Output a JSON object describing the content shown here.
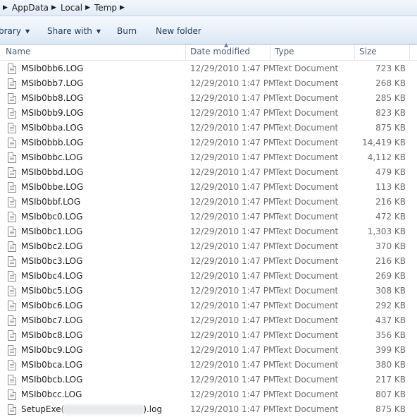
{
  "address": {
    "crumbs": [
      "AppData",
      "Local",
      "Temp"
    ]
  },
  "toolbar": {
    "library_label": "brary",
    "share_label": "Share with",
    "burn_label": "Burn",
    "new_folder_label": "New folder"
  },
  "columns": {
    "name": "Name",
    "date": "Date modified",
    "type": "Type",
    "size": "Size"
  },
  "files": [
    {
      "name": "MSIb0bb6.LOG",
      "date": "12/29/2010 1:47 PM",
      "type": "Text Document",
      "size": "723 KB"
    },
    {
      "name": "MSIb0bb7.LOG",
      "date": "12/29/2010 1:47 PM",
      "type": "Text Document",
      "size": "268 KB"
    },
    {
      "name": "MSIb0bb8.LOG",
      "date": "12/29/2010 1:47 PM",
      "type": "Text Document",
      "size": "285 KB"
    },
    {
      "name": "MSIb0bb9.LOG",
      "date": "12/29/2010 1:47 PM",
      "type": "Text Document",
      "size": "823 KB"
    },
    {
      "name": "MSIb0bba.LOG",
      "date": "12/29/2010 1:47 PM",
      "type": "Text Document",
      "size": "875 KB"
    },
    {
      "name": "MSIb0bbb.LOG",
      "date": "12/29/2010 1:47 PM",
      "type": "Text Document",
      "size": "14,419 KB"
    },
    {
      "name": "MSIb0bbc.LOG",
      "date": "12/29/2010 1:47 PM",
      "type": "Text Document",
      "size": "4,112 KB"
    },
    {
      "name": "MSIb0bbd.LOG",
      "date": "12/29/2010 1:47 PM",
      "type": "Text Document",
      "size": "479 KB"
    },
    {
      "name": "MSIb0bbe.LOG",
      "date": "12/29/2010 1:47 PM",
      "type": "Text Document",
      "size": "113 KB"
    },
    {
      "name": "MSIb0bbf.LOG",
      "date": "12/29/2010 1:47 PM",
      "type": "Text Document",
      "size": "216 KB"
    },
    {
      "name": "MSIb0bc0.LOG",
      "date": "12/29/2010 1:47 PM",
      "type": "Text Document",
      "size": "472 KB"
    },
    {
      "name": "MSIb0bc1.LOG",
      "date": "12/29/2010 1:47 PM",
      "type": "Text Document",
      "size": "1,303 KB"
    },
    {
      "name": "MSIb0bc2.LOG",
      "date": "12/29/2010 1:47 PM",
      "type": "Text Document",
      "size": "370 KB"
    },
    {
      "name": "MSIb0bc3.LOG",
      "date": "12/29/2010 1:47 PM",
      "type": "Text Document",
      "size": "216 KB"
    },
    {
      "name": "MSIb0bc4.LOG",
      "date": "12/29/2010 1:47 PM",
      "type": "Text Document",
      "size": "269 KB"
    },
    {
      "name": "MSIb0bc5.LOG",
      "date": "12/29/2010 1:47 PM",
      "type": "Text Document",
      "size": "308 KB"
    },
    {
      "name": "MSIb0bc6.LOG",
      "date": "12/29/2010 1:47 PM",
      "type": "Text Document",
      "size": "292 KB"
    },
    {
      "name": "MSIb0bc7.LOG",
      "date": "12/29/2010 1:47 PM",
      "type": "Text Document",
      "size": "437 KB"
    },
    {
      "name": "MSIb0bc8.LOG",
      "date": "12/29/2010 1:47 PM",
      "type": "Text Document",
      "size": "356 KB"
    },
    {
      "name": "MSIb0bc9.LOG",
      "date": "12/29/2010 1:47 PM",
      "type": "Text Document",
      "size": "399 KB"
    },
    {
      "name": "MSIb0bca.LOG",
      "date": "12/29/2010 1:47 PM",
      "type": "Text Document",
      "size": "380 KB"
    },
    {
      "name": "MSIb0bcb.LOG",
      "date": "12/29/2010 1:47 PM",
      "type": "Text Document",
      "size": "217 KB"
    },
    {
      "name": "MSIb0bcc.LOG",
      "date": "12/29/2010 1:47 PM",
      "type": "Text Document",
      "size": "807 KB"
    }
  ],
  "last_file": {
    "name_prefix": "SetupExe(",
    "name_suffix": ").log",
    "date": "12/29/2010 1:47 PM",
    "type": "Text Document",
    "size": "875 KB"
  }
}
